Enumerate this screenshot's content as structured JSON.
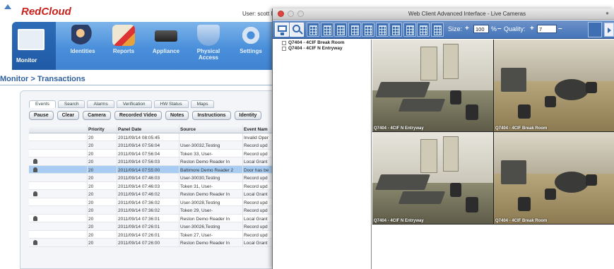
{
  "app": {
    "logo": "RedCloud",
    "user_label": "User: scott l",
    "nav": [
      "Monitor",
      "Identities",
      "Reports",
      "Appliance",
      "Physical Access",
      "Settings"
    ],
    "breadcrumb": "Monitor > Transactions",
    "tabs": [
      "Events",
      "Search",
      "Alarms",
      "Verification",
      "HW Status",
      "Maps"
    ],
    "buttons": [
      "Pause",
      "Clear",
      "Camera",
      "Recorded Video",
      "Notes",
      "Instructions",
      "Identity"
    ],
    "table": {
      "columns": [
        "",
        "Priority",
        "Panel Date",
        "Source",
        "Event Nam"
      ],
      "rows": [
        {
          "icon": "",
          "priority": "20",
          "date": "2011/09/14 08:05:45",
          "source": "",
          "event": "Invalid Oper"
        },
        {
          "icon": "",
          "priority": "20",
          "date": "2011/09/14 07:56:04",
          "source": "User-30032,Testing",
          "event": "Record upd"
        },
        {
          "icon": "",
          "priority": "20",
          "date": "2011/09/14 07:56:04",
          "source": "Token 33, User-",
          "event": "Record upd"
        },
        {
          "icon": "camera",
          "priority": "20",
          "date": "2011/09/14 07:56:03",
          "source": "Reston Demo Reader In",
          "event": "Local Grant"
        },
        {
          "icon": "camera",
          "priority": "20",
          "date": "2011/09/14 07:55:00",
          "source": "Baltimore Demo Reader 2",
          "event": "Door has be",
          "selected": true
        },
        {
          "icon": "",
          "priority": "20",
          "date": "2011/09/14 07:46:03",
          "source": "User-30030,Testing",
          "event": "Record upd"
        },
        {
          "icon": "",
          "priority": "20",
          "date": "2011/09/14 07:46:03",
          "source": "Token 31, User-",
          "event": "Record upd"
        },
        {
          "icon": "camera",
          "priority": "20",
          "date": "2011/09/14 07:46:02",
          "source": "Reston Demo Reader In",
          "event": "Local Grant"
        },
        {
          "icon": "",
          "priority": "20",
          "date": "2011/09/14 07:36:02",
          "source": "User-30028,Testing",
          "event": "Record upd"
        },
        {
          "icon": "",
          "priority": "20",
          "date": "2011/09/14 07:36:02",
          "source": "Token 29, User-",
          "event": "Record upd"
        },
        {
          "icon": "camera",
          "priority": "20",
          "date": "2011/09/14 07:36:01",
          "source": "Reston Demo Reader In",
          "event": "Local Grant"
        },
        {
          "icon": "",
          "priority": "20",
          "date": "2011/09/14 07:26:01",
          "source": "User-30026,Testing",
          "event": "Record upd"
        },
        {
          "icon": "",
          "priority": "20",
          "date": "2011/09/14 07:26:01",
          "source": "Token 27, User-",
          "event": "Record upd"
        },
        {
          "icon": "camera",
          "priority": "20",
          "date": "2011/09/14 07:26:00",
          "source": "Reston Demo Reader In",
          "event": "Local Grant"
        }
      ]
    }
  },
  "window": {
    "title": "Web Client Advanced Interface - Live Cameras",
    "size_label": "Size:",
    "size_value": "100",
    "percent": "%",
    "quality_label": "Quality:",
    "quality_value": "7",
    "plus": "+",
    "minus": "–",
    "tree_items": [
      "Q7404 - 4CIF Break Room",
      "Q7404 - 4CIF N Entryway"
    ],
    "cameras": [
      {
        "caption": "Q7404 - 4CIF N Entryway",
        "scene": "entryway"
      },
      {
        "caption": "Q7404 - 4CIF Break Room",
        "scene": "room"
      },
      {
        "caption": "Q7404 - 4CIF N Entryway",
        "scene": "entryway"
      },
      {
        "caption": "Q7404 - 4CIF Break Room",
        "scene": "room"
      }
    ],
    "layout_buttons": 10
  }
}
